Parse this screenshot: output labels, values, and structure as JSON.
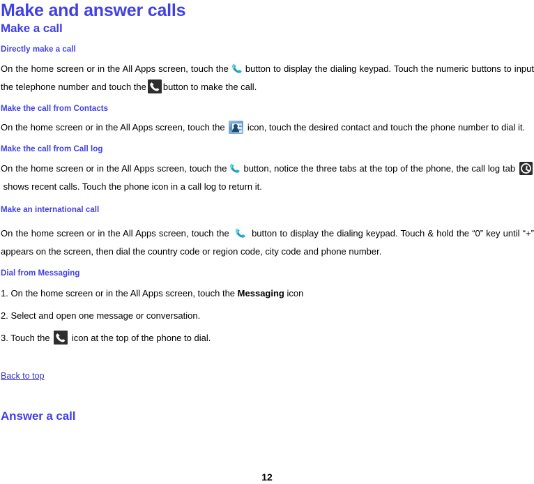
{
  "document": {
    "title": "Make and answer calls",
    "section_title": "Make a call",
    "page_number": "12"
  },
  "sections": [
    {
      "heading": "Directly make a call",
      "paragraph_1_a": "On the home screen or in the All Apps screen, touch the",
      "icon_1": "phone-light-icon",
      "paragraph_1_b": "button to display the dialing keypad. Touch the numeric buttons to input the telephone number and touch the",
      "icon_2": "phone-dark-icon",
      "paragraph_1_c": "button to make the call."
    },
    {
      "heading": "Make the call from Contacts",
      "paragraph_a": "On the home screen or in the All Apps screen, touch the",
      "icon": "contacts-icon",
      "paragraph_b": "icon, touch the desired contact and touch the phone number to dial it."
    },
    {
      "heading": "Make the call from Call log",
      "paragraph_a": "On the home screen or in the All Apps screen, touch the",
      "icon_1": "phone-light-icon",
      "paragraph_b": "button, notice the three tabs at the top of the phone, the call log tab",
      "icon_2": "clock-icon",
      "paragraph_c": "shows recent calls. Touch the phone icon in a call log to return it."
    },
    {
      "heading": "Make an international call",
      "paragraph_a": "On the home screen or in the All Apps screen, touch the",
      "icon": "phone-light-icon",
      "paragraph_b": "button to display the dialing keypad. Touch & hold the",
      "paragraph_c": "“0” key until “+” appears on the screen, then dial the country code or region code, city code and phone number."
    },
    {
      "heading": "Dial from Messaging",
      "step_1_a": "1. On the home screen or in the All Apps screen, touch the",
      "step_1_bold": "Messaging",
      "step_1_b": "icon",
      "step_2": "2. Select and open one message or conversation.",
      "step_3_a": "3. Touch the",
      "step_3_icon": "phone-dark-icon",
      "step_3_b": "icon at the top of the phone to dial."
    }
  ],
  "footer": {
    "back_to_top": "Back to top",
    "next_section_title": "Answer a call"
  },
  "colors": {
    "heading": "#4140E3",
    "link": "#3333CC",
    "body_text": "#000000",
    "background": "#FFFFFF"
  }
}
